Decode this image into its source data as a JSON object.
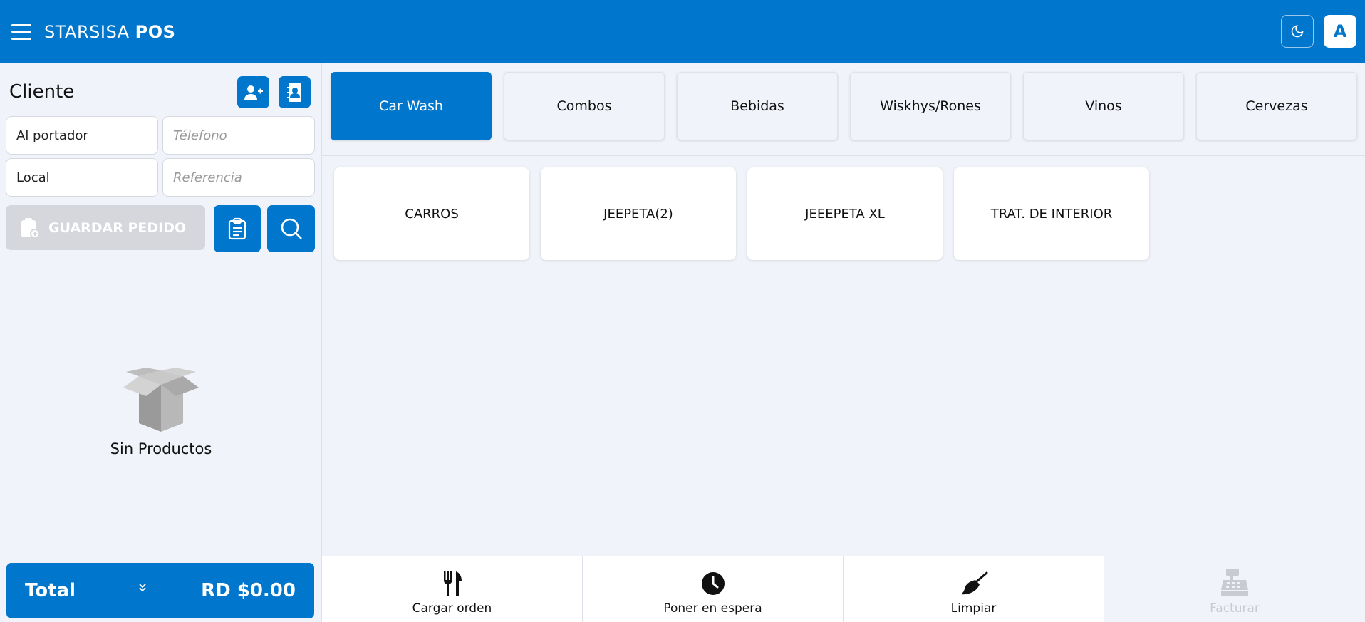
{
  "header": {
    "brand_light": "STARSISA ",
    "brand_bold": "POS",
    "avatar_letter": "A"
  },
  "colors": {
    "primary": "#0077cc",
    "background": "#f1f3fa",
    "disabled": "#d5d7dc"
  },
  "client": {
    "title": "Cliente",
    "name_value": "Al portador",
    "phone_placeholder": "Télefono",
    "location_value": "Local",
    "reference_placeholder": "Referencia",
    "save_label": "GUARDAR PEDIDO"
  },
  "cart": {
    "empty_label": "Sin Productos",
    "total_label": "Total",
    "total_amount": "RD $0.00"
  },
  "categories": [
    {
      "label": "Car Wash"
    },
    {
      "label": "Combos"
    },
    {
      "label": "Bebidas"
    },
    {
      "label": "Wiskhys/Rones"
    },
    {
      "label": "Vinos"
    },
    {
      "label": "Cervezas"
    }
  ],
  "products": [
    {
      "label": "CARROS"
    },
    {
      "label": "JEEPETA(2)"
    },
    {
      "label": "JEEEPETA XL"
    },
    {
      "label": "TRAT. DE INTERIOR"
    }
  ],
  "actions": [
    {
      "label": "Cargar orden",
      "icon": "utensils-icon"
    },
    {
      "label": "Poner en espera",
      "icon": "clock-icon"
    },
    {
      "label": "Limpiar",
      "icon": "broom-icon"
    },
    {
      "label": "Facturar",
      "icon": "cash-register-icon"
    }
  ]
}
